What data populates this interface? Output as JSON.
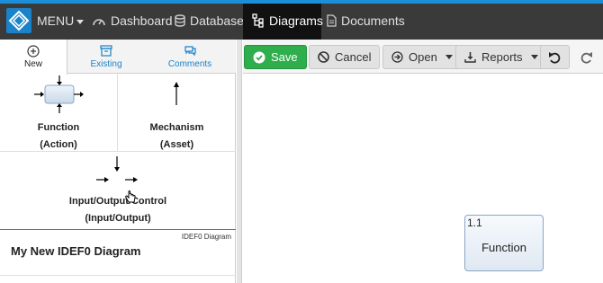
{
  "navbar": {
    "menu_label": "MENU",
    "items": [
      {
        "label": "Dashboard",
        "icon": "dashboard-icon"
      },
      {
        "label": "Database",
        "icon": "database-icon"
      },
      {
        "label": "Diagrams",
        "icon": "diagram-icon",
        "active": true
      },
      {
        "label": "Documents",
        "icon": "document-icon"
      }
    ],
    "colors": {
      "bar": "#3a3a3a",
      "active": "#111111",
      "accent": "#1a82c8"
    }
  },
  "left_panel": {
    "tabs": [
      {
        "label": "New",
        "icon": "plus-circle-icon",
        "active": true
      },
      {
        "label": "Existing",
        "icon": "archive-box-icon"
      },
      {
        "label": "Comments",
        "icon": "comments-icon"
      }
    ],
    "shapes": [
      {
        "title": "Function",
        "subtitle": "(Action)"
      },
      {
        "title": "Mechanism",
        "subtitle": "(Asset)"
      },
      {
        "title": "Input/Output/Control",
        "subtitle": "(Input/Output)"
      }
    ],
    "diagram_type": "IDEF0 Diagram",
    "diagram_title": "My New IDEF0 Diagram"
  },
  "toolbar": {
    "save": "Save",
    "cancel": "Cancel",
    "open": "Open",
    "reports": "Reports",
    "save_color": "#2eae4c"
  },
  "canvas": {
    "function_box": {
      "id": "1.1",
      "label": "Function"
    }
  }
}
